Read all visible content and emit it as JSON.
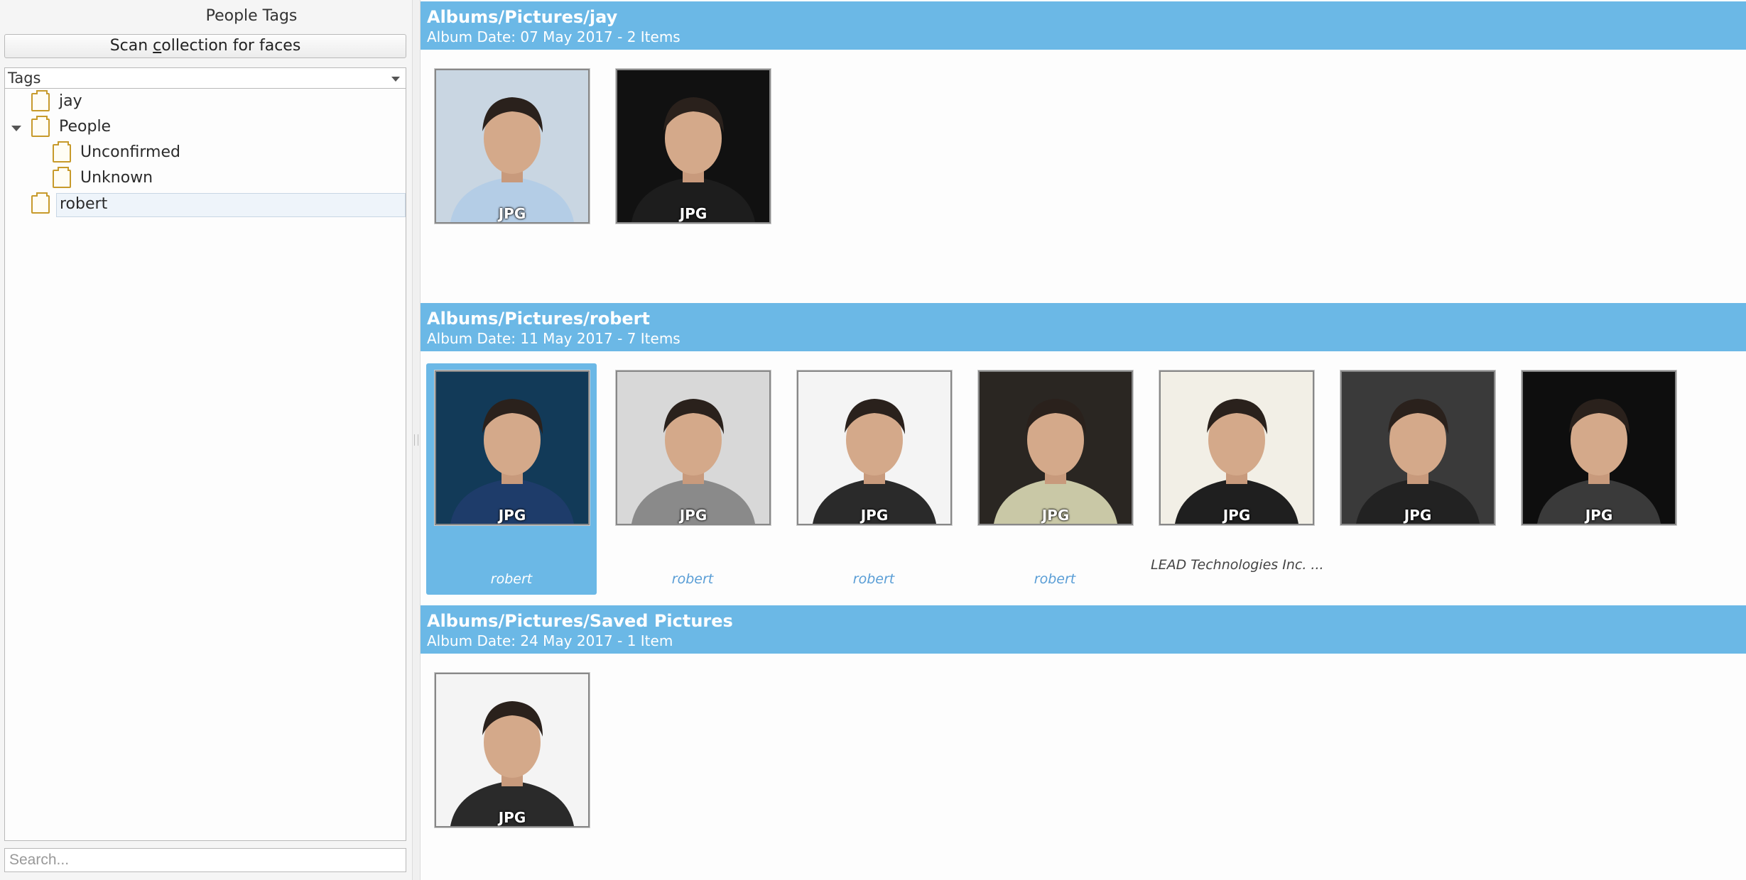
{
  "left_panel": {
    "title": "People Tags",
    "scan_button": {
      "pre": "Scan ",
      "underlined": "c",
      "post": "ollection for faces"
    },
    "tags_combo": "Tags",
    "tree": [
      {
        "label": "jay"
      },
      {
        "label": "People",
        "expanded": true
      },
      {
        "label": "Unconfirmed"
      },
      {
        "label": "Unknown"
      },
      {
        "label": "robert",
        "selected": true
      }
    ],
    "search_placeholder": "Search..."
  },
  "icon_view": {
    "groups": [
      {
        "title": "Albums/Pictures/jay",
        "subtitle": "Album Date: 07 May 2017 - 2 Items",
        "items": [
          {
            "format": "JPG",
            "caption": "",
            "tone": "color-light",
            "bg": "#c9d6e2",
            "shirt": "#b4cde6"
          },
          {
            "format": "JPG",
            "caption": "",
            "tone": "color-dark",
            "bg": "#111111",
            "shirt": "#1d1d1d"
          }
        ]
      },
      {
        "title": "Albums/Pictures/robert",
        "subtitle": "Album Date: 11 May 2017 - 7 Items",
        "items": [
          {
            "format": "JPG",
            "caption": "robert",
            "selected": true,
            "bg": "#123a58",
            "shirt": "#1e3c6a"
          },
          {
            "format": "JPG",
            "caption": "robert",
            "bg": "#d8d8d8",
            "shirt": "#8a8a8a"
          },
          {
            "format": "JPG",
            "caption": "robert",
            "bg": "#f4f4f4",
            "shirt": "#2a2a2a"
          },
          {
            "format": "JPG",
            "caption": "robert",
            "bg": "#2a2622",
            "shirt": "#c9c8a6"
          },
          {
            "format": "JPG",
            "caption": "LEAD Technologies Inc. ...",
            "meta": true,
            "bg": "#f2efe6",
            "shirt": "#1f1f1f"
          },
          {
            "format": "JPG",
            "caption": "",
            "bg": "#3a3a3a",
            "shirt": "#222222"
          },
          {
            "format": "JPG",
            "caption": "",
            "bg": "#0e0e0e",
            "shirt": "#3a3a3a"
          }
        ]
      },
      {
        "title": "Albums/Pictures/Saved Pictures",
        "subtitle": "Album Date: 24 May 2017 - 1 Item",
        "items": [
          {
            "format": "JPG",
            "caption": "",
            "bg": "#f4f4f4",
            "shirt": "#2a2a2a"
          }
        ]
      }
    ]
  }
}
